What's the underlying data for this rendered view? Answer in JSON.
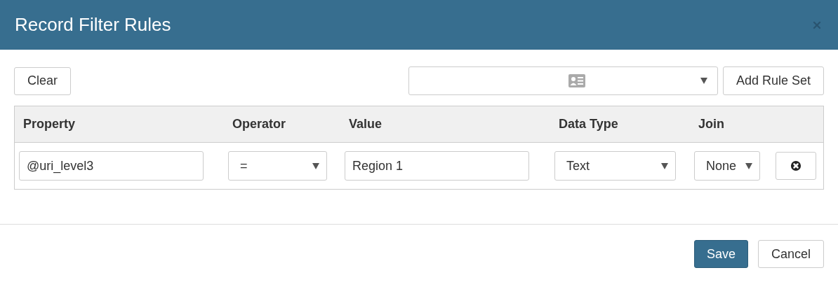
{
  "dialog": {
    "title": "Record Filter Rules"
  },
  "toolbar": {
    "clear_button": "Clear",
    "add_button": "Add Rule Set"
  },
  "table": {
    "columns": [
      "Property",
      "Operator",
      "Value",
      "Data Type",
      "Join"
    ],
    "rows": [
      {
        "property": "@uri_level3",
        "operator": "=",
        "value": "Region 1",
        "data_type": "Text",
        "join": "None"
      }
    ]
  },
  "footer": {
    "buttons": [
      {
        "label": "Save",
        "kind": "primary"
      },
      {
        "label": "Cancel",
        "kind": "default"
      }
    ]
  }
}
